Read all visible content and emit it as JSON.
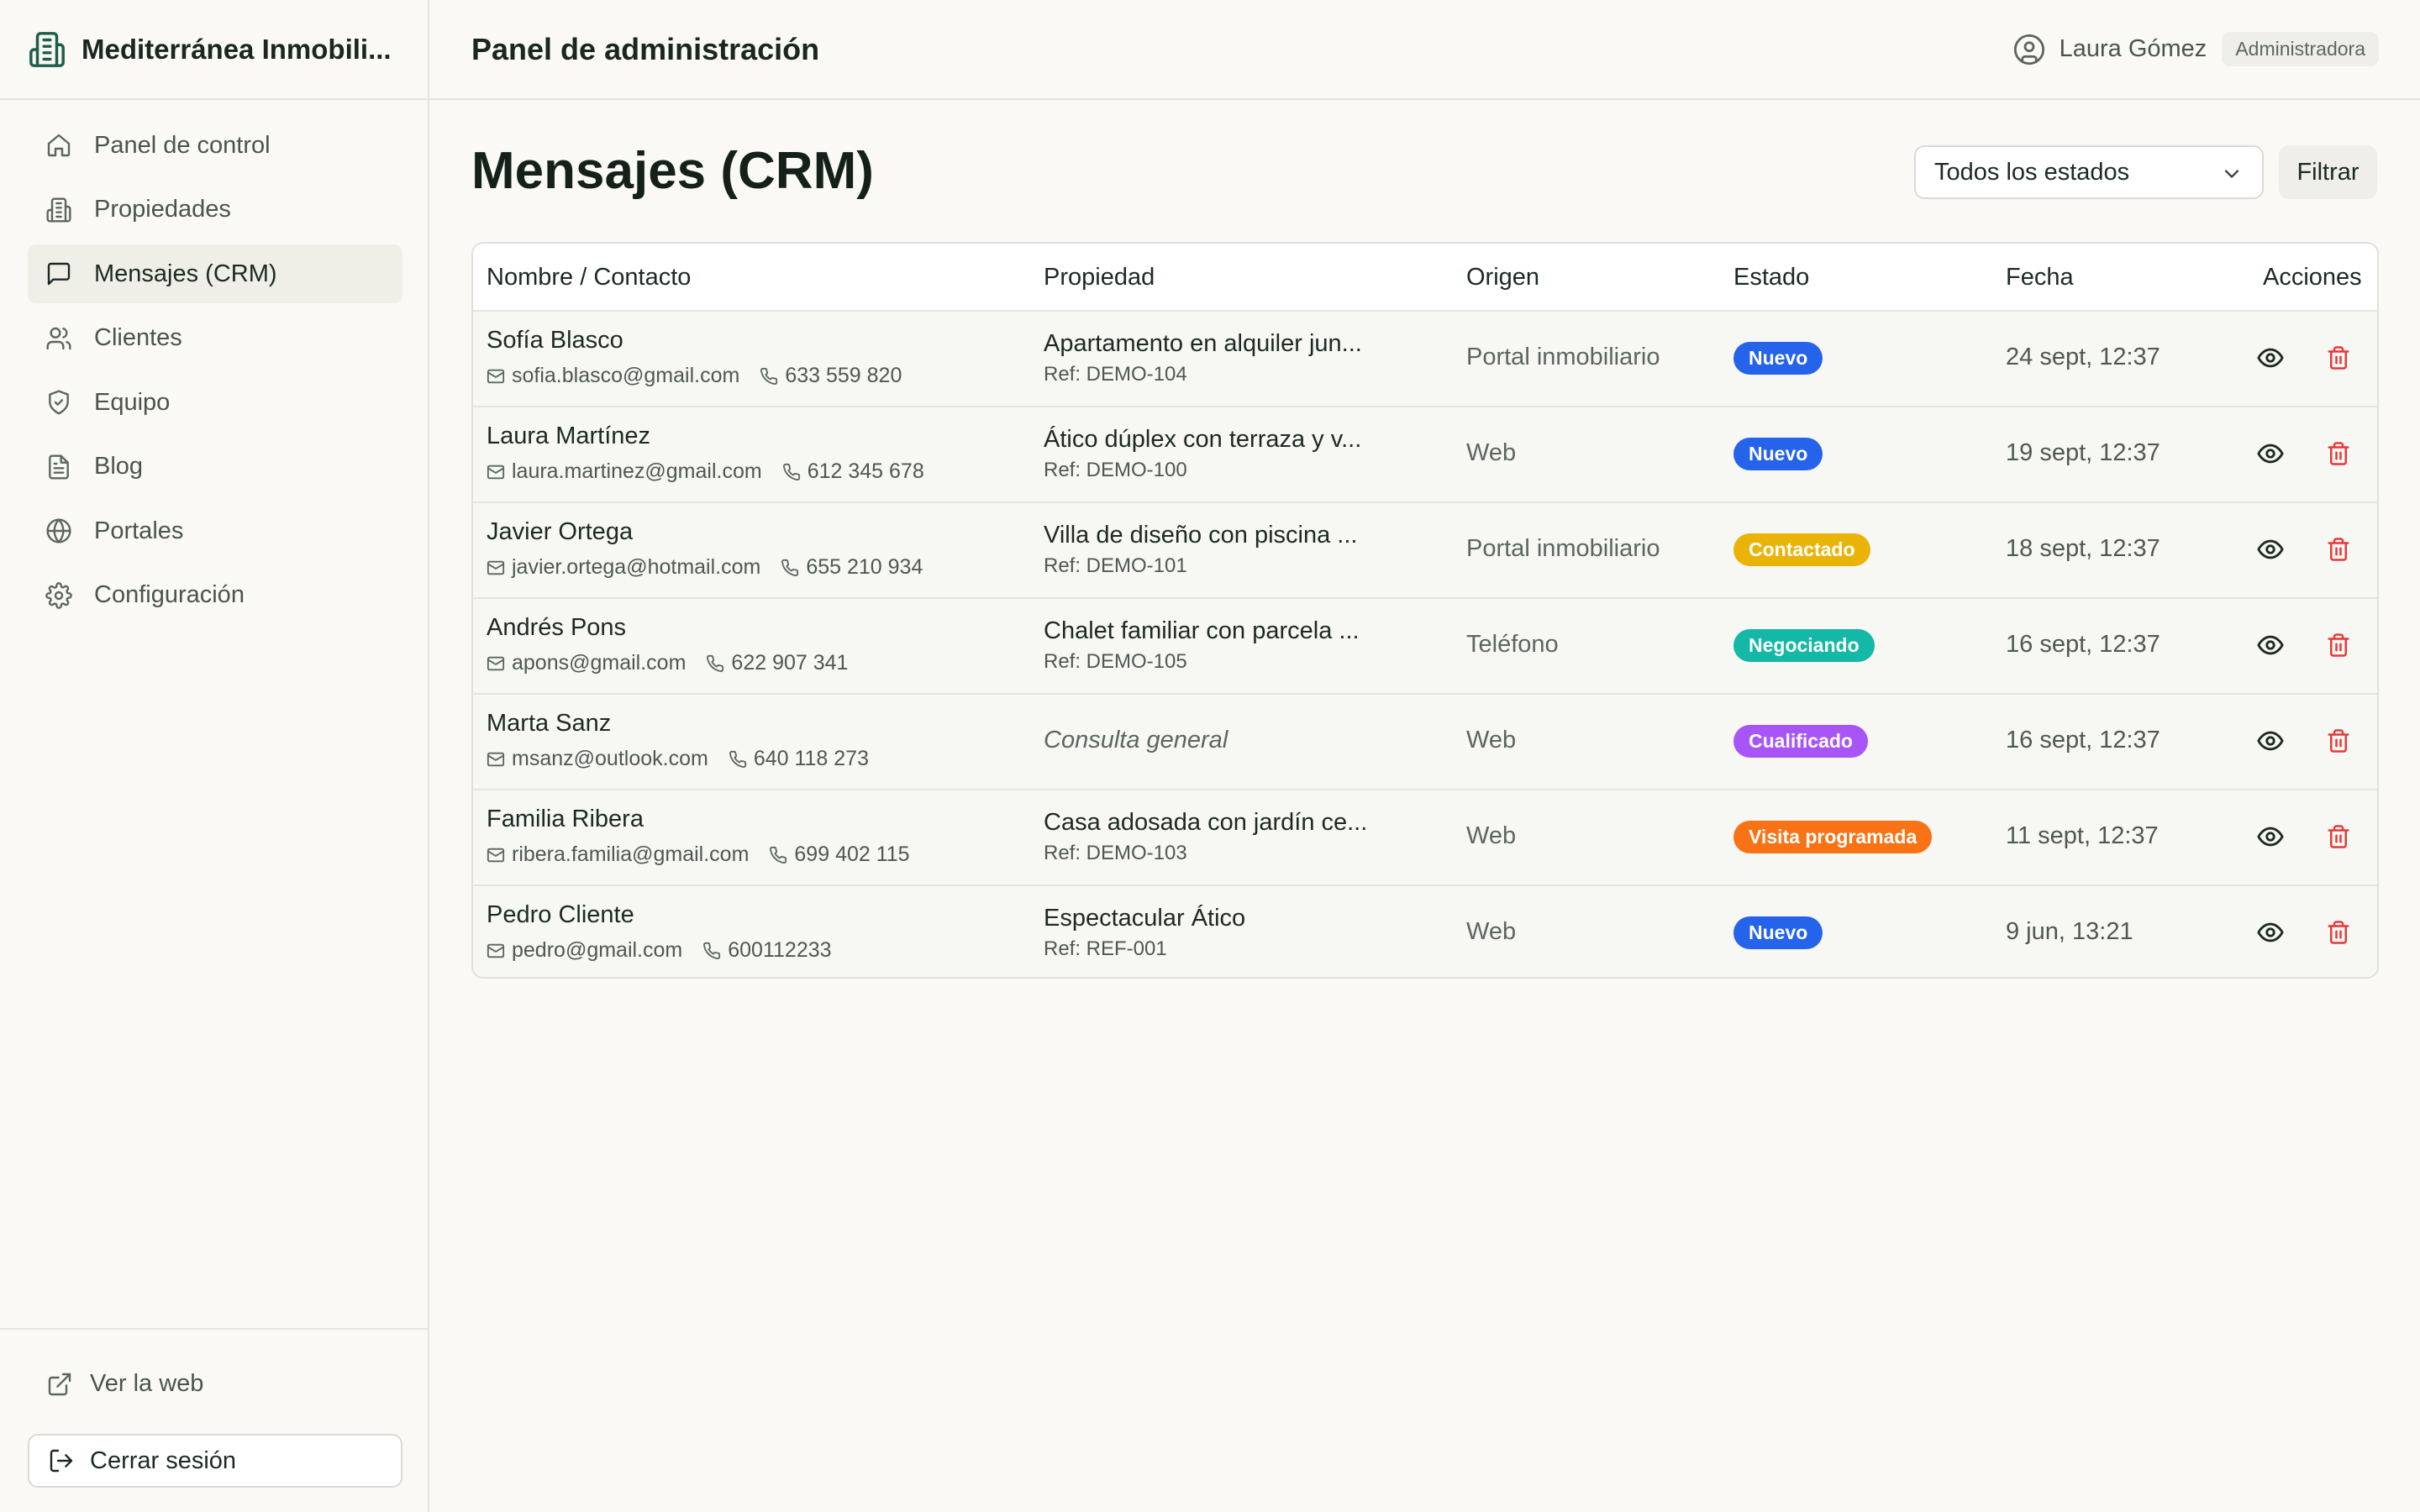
{
  "brand": {
    "name": "Mediterránea Inmobili..."
  },
  "sidebar": {
    "items": [
      {
        "label": "Panel de control",
        "icon": "home-icon",
        "active": false
      },
      {
        "label": "Propiedades",
        "icon": "building-icon",
        "active": false
      },
      {
        "label": "Mensajes (CRM)",
        "icon": "message-icon",
        "active": true
      },
      {
        "label": "Clientes",
        "icon": "users-icon",
        "active": false
      },
      {
        "label": "Equipo",
        "icon": "shield-icon",
        "active": false
      },
      {
        "label": "Blog",
        "icon": "document-icon",
        "active": false
      },
      {
        "label": "Portales",
        "icon": "globe-icon",
        "active": false
      },
      {
        "label": "Configuración",
        "icon": "gear-icon",
        "active": false
      }
    ],
    "view_web": "Ver la web",
    "logout": "Cerrar sesión"
  },
  "header": {
    "title": "Panel de administración",
    "user_name": "Laura Gómez",
    "role": "Administradora"
  },
  "main": {
    "heading": "Mensajes (CRM)",
    "status_filter": "Todos los estados",
    "filter_button": "Filtrar"
  },
  "table": {
    "columns": [
      "Nombre / Contacto",
      "Propiedad",
      "Origen",
      "Estado",
      "Fecha",
      "Acciones"
    ],
    "rows": [
      {
        "name": "Sofía Blasco",
        "email": "sofia.blasco@gmail.com",
        "phone": "633 559 820",
        "property": "Apartamento en alquiler jun...",
        "ref": "Ref: DEMO-104",
        "origin": "Portal inmobiliario",
        "status": "Nuevo",
        "status_color": "#2563eb",
        "date": "24 sept, 12:37"
      },
      {
        "name": "Laura Martínez",
        "email": "laura.martinez@gmail.com",
        "phone": "612 345 678",
        "property": "Ático dúplex con terraza y v...",
        "ref": "Ref: DEMO-100",
        "origin": "Web",
        "status": "Nuevo",
        "status_color": "#2563eb",
        "date": "19 sept, 12:37"
      },
      {
        "name": "Javier Ortega",
        "email": "javier.ortega@hotmail.com",
        "phone": "655 210 934",
        "property": "Villa de diseño con piscina ...",
        "ref": "Ref: DEMO-101",
        "origin": "Portal inmobiliario",
        "status": "Contactado",
        "status_color": "#eab308",
        "date": "18 sept, 12:37"
      },
      {
        "name": "Andrés Pons",
        "email": "apons@gmail.com",
        "phone": "622 907 341",
        "property": "Chalet familiar con parcela ...",
        "ref": "Ref: DEMO-105",
        "origin": "Teléfono",
        "status": "Negociando",
        "status_color": "#14b8a6",
        "date": "16 sept, 12:37"
      },
      {
        "name": "Marta Sanz",
        "email": "msanz@outlook.com",
        "phone": "640 118 273",
        "property": "Consulta general",
        "ref": "",
        "origin": "Web",
        "status": "Cualificado",
        "status_color": "#a855f7",
        "date": "16 sept, 12:37"
      },
      {
        "name": "Familia Ribera",
        "email": "ribera.familia@gmail.com",
        "phone": "699 402 115",
        "property": "Casa adosada con jardín ce...",
        "ref": "Ref: DEMO-103",
        "origin": "Web",
        "status": "Visita programada",
        "status_color": "#f97316",
        "date": "11 sept, 12:37"
      },
      {
        "name": "Pedro Cliente",
        "email": "pedro@gmail.com",
        "phone": "600112233",
        "property": "Espectacular Ático",
        "ref": "Ref: REF-001",
        "origin": "Web",
        "status": "Nuevo",
        "status_color": "#2563eb",
        "date": "9 jun, 13:21"
      }
    ]
  }
}
